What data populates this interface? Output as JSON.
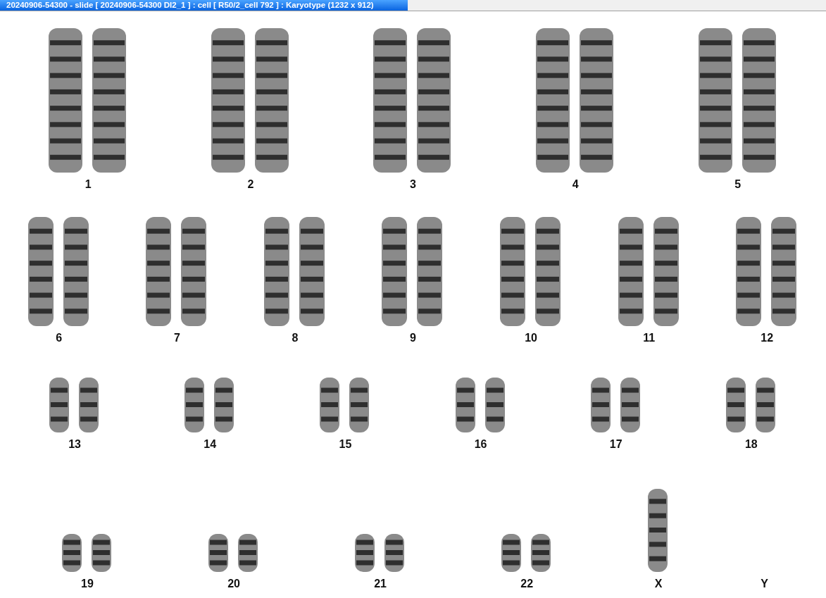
{
  "window": {
    "title": "20240906-54300 - slide [ 20240906-54300 DI2_1 ] : cell [ R50/2_cell 792 ] : Karyotype  (1232 x 912)"
  },
  "rows": [
    {
      "groups": [
        {
          "label": "1",
          "kind": "pair"
        },
        {
          "label": "2",
          "kind": "pair"
        },
        {
          "label": "3",
          "kind": "pair"
        },
        {
          "label": "4",
          "kind": "pair"
        },
        {
          "label": "5",
          "kind": "pair"
        }
      ]
    },
    {
      "groups": [
        {
          "label": "6",
          "kind": "pair"
        },
        {
          "label": "7",
          "kind": "pair"
        },
        {
          "label": "8",
          "kind": "pair"
        },
        {
          "label": "9",
          "kind": "pair"
        },
        {
          "label": "10",
          "kind": "pair"
        },
        {
          "label": "11",
          "kind": "pair"
        },
        {
          "label": "12",
          "kind": "pair"
        }
      ]
    },
    {
      "groups": [
        {
          "label": "13",
          "kind": "pair"
        },
        {
          "label": "14",
          "kind": "pair"
        },
        {
          "label": "15",
          "kind": "pair"
        },
        {
          "label": "16",
          "kind": "pair"
        },
        {
          "label": "17",
          "kind": "pair"
        },
        {
          "label": "18",
          "kind": "pair"
        }
      ]
    },
    {
      "groups": [
        {
          "label": "19",
          "kind": "pair"
        },
        {
          "label": "20",
          "kind": "pair"
        },
        {
          "label": "21",
          "kind": "pair"
        },
        {
          "label": "22",
          "kind": "pair"
        },
        {
          "label": "X",
          "kind": "single"
        },
        {
          "label": "Y",
          "kind": "none"
        }
      ]
    }
  ]
}
